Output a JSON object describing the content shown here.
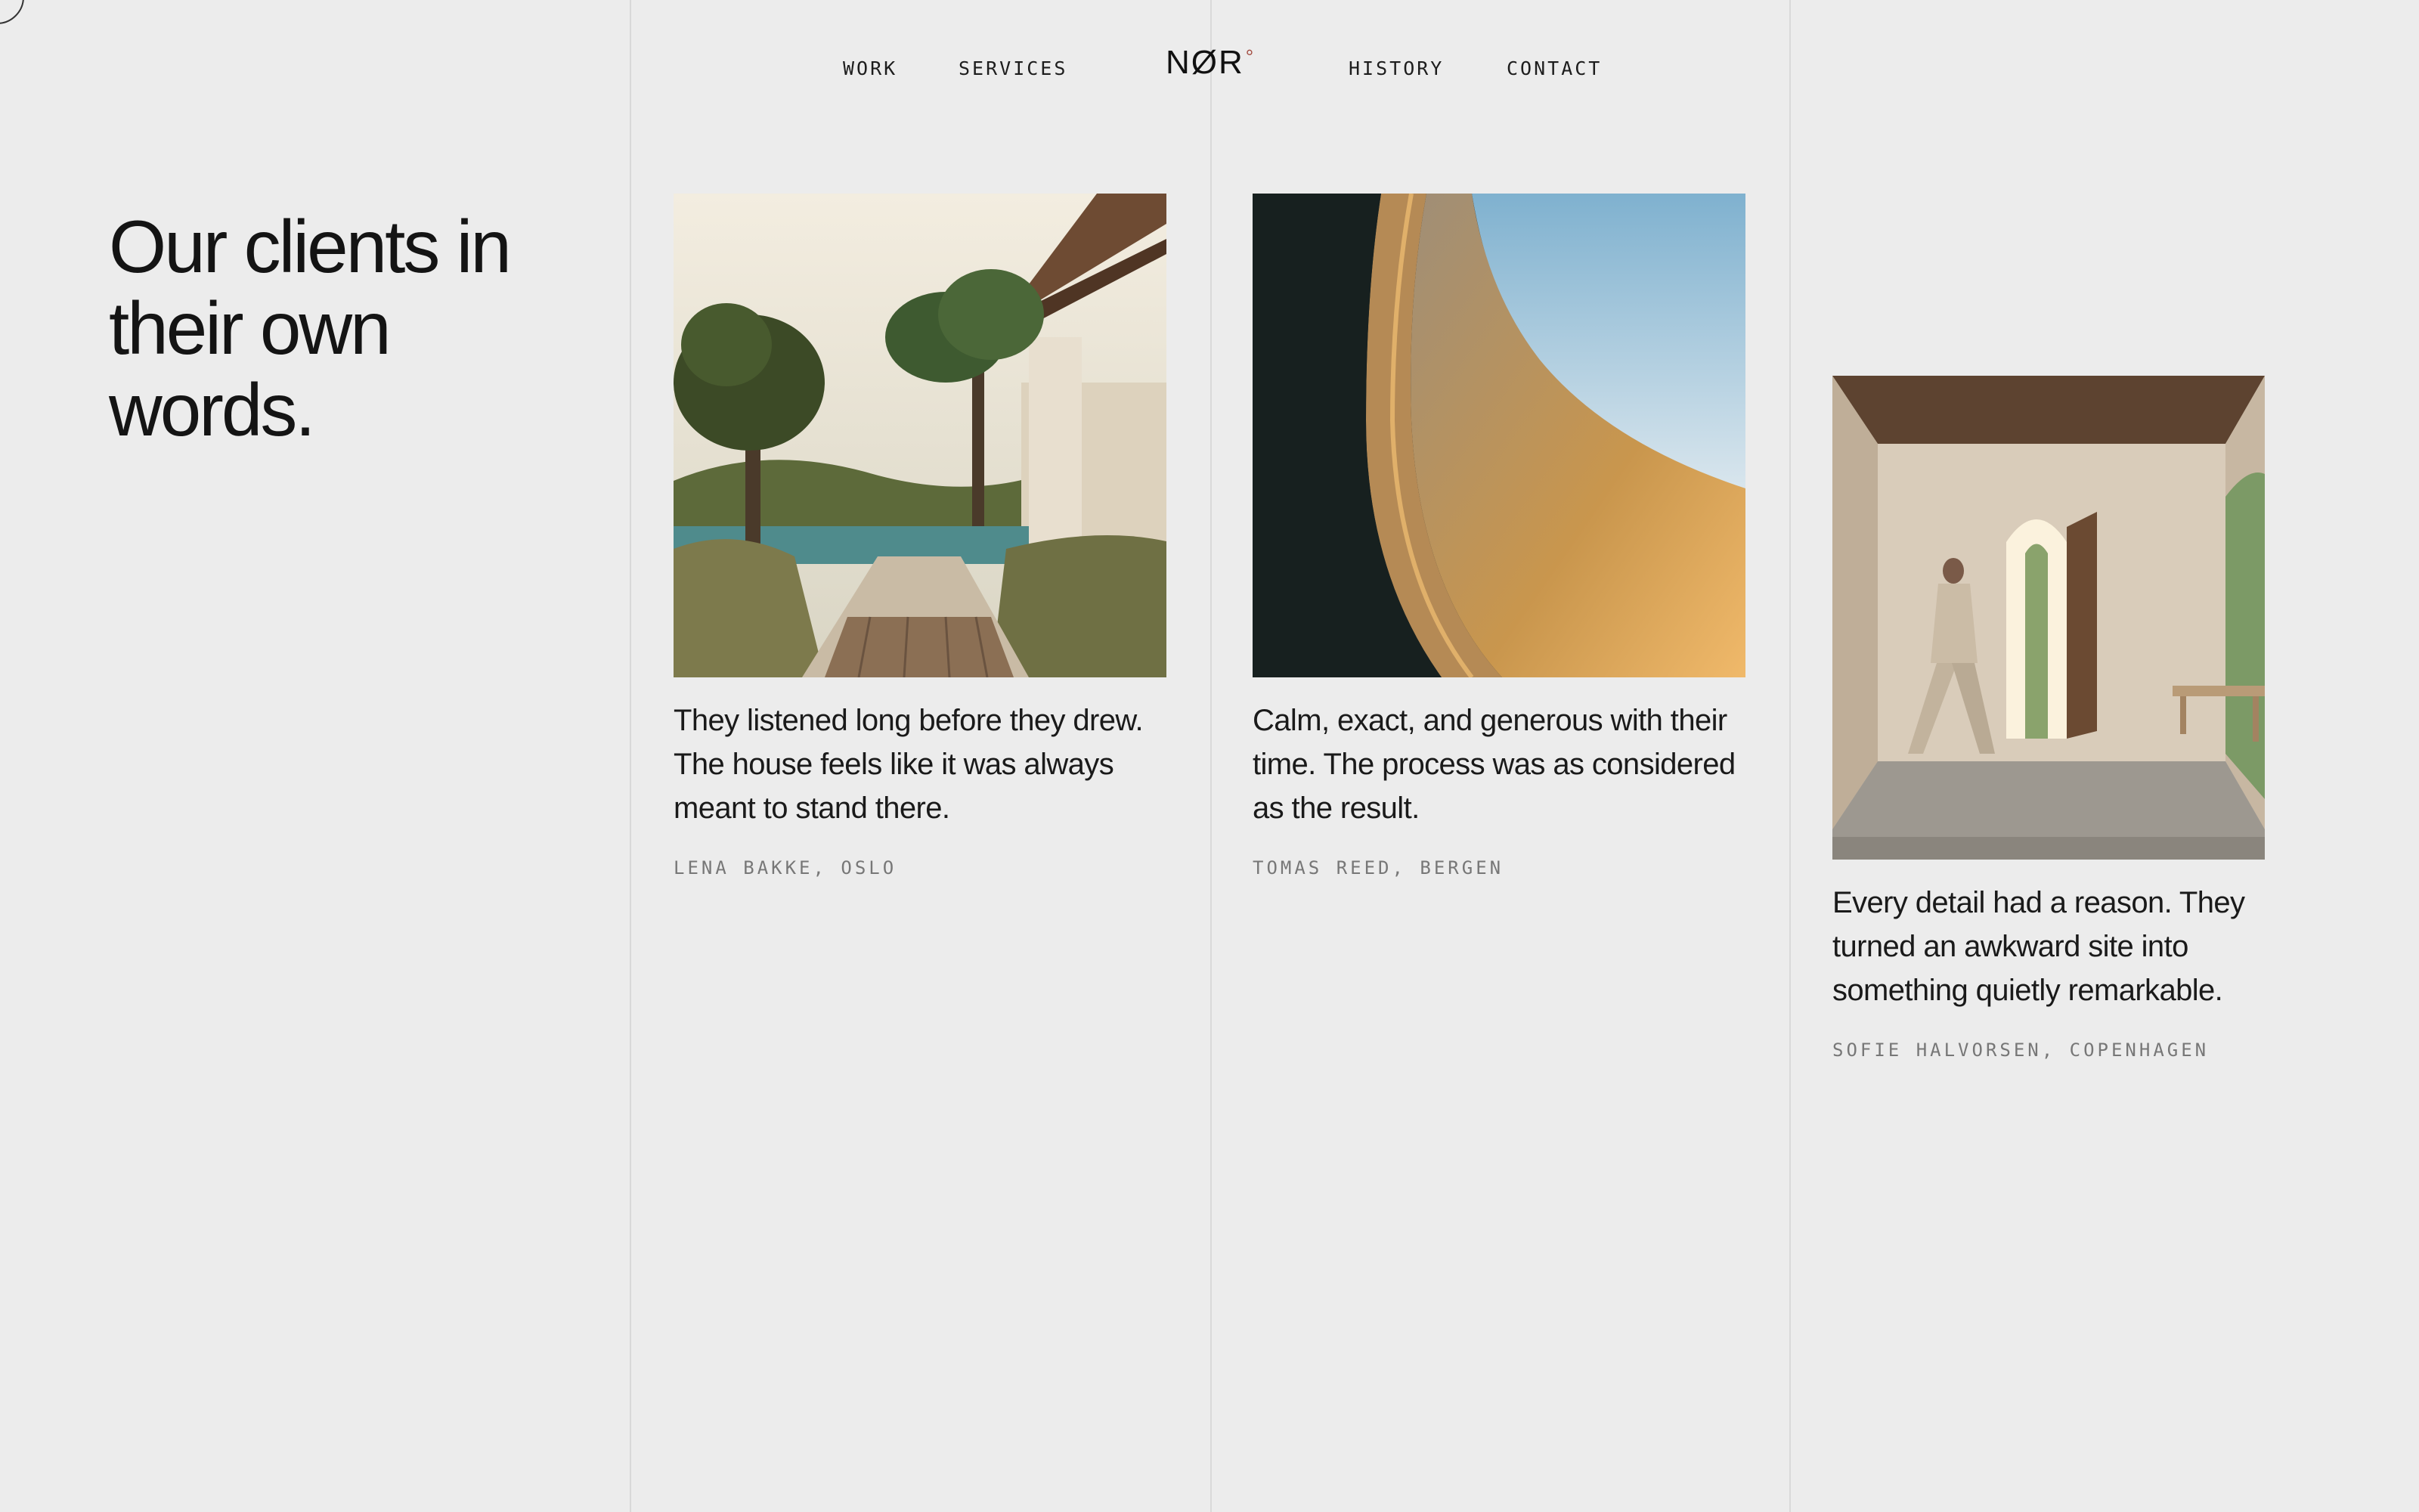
{
  "nav": {
    "left": [
      "WORK",
      "SERVICES"
    ],
    "logo": "NØR",
    "logo_mark": "°",
    "right": [
      "HISTORY",
      "CONTACT"
    ]
  },
  "hero": {
    "headline": "Our clients in their own words."
  },
  "testimonials": [
    {
      "quote": "They listened long before they drew. The house feels like it was always meant to stand there.",
      "author": "LENA BAKKE, OSLO",
      "image": "garden-path-photo"
    },
    {
      "quote": "Calm, exact, and generous with their time. The process was as considered as the result.",
      "author": "TOMAS REED, BERGEN",
      "image": "curved-concrete-photo"
    },
    {
      "quote": "Every detail had a reason. They turned an awkward site into something quietly remarkable.",
      "author": "SOFIE HALVORSEN, COPENHAGEN",
      "image": "arched-interior-photo"
    }
  ],
  "colors": {
    "background": "#ececec",
    "text": "#141414",
    "muted": "#777777",
    "divider": "#d9d9d9",
    "accent": "#a24b40"
  }
}
